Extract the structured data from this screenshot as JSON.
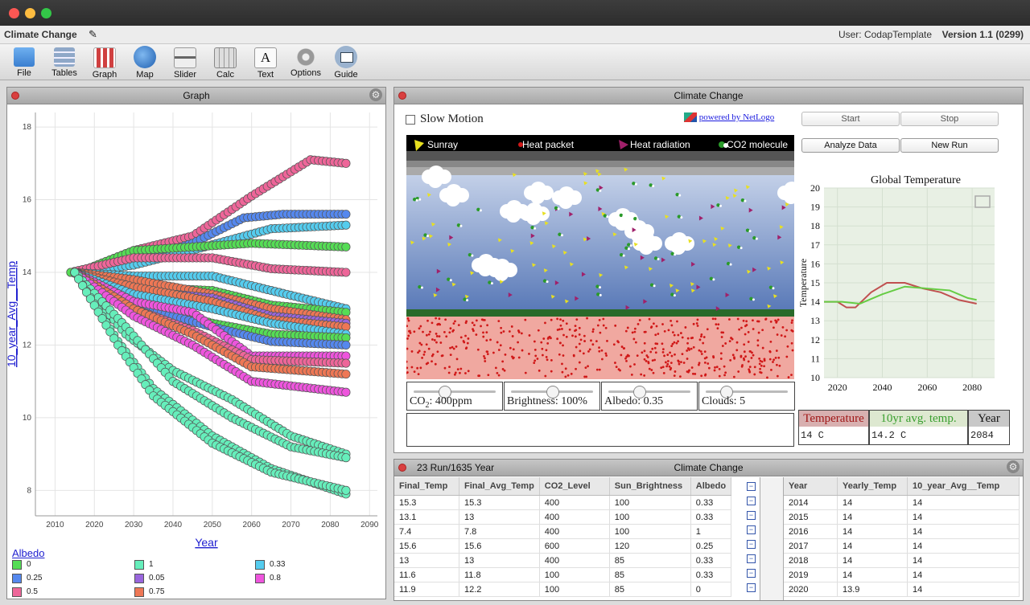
{
  "app": {
    "title": "Climate Change",
    "user": "User: CodapTemplate",
    "version": "Version 1.1 (0299)"
  },
  "toolbar": [
    {
      "label": "File",
      "icon": "folder-icon",
      "color": "#4a8fd8"
    },
    {
      "label": "Tables",
      "icon": "table-icon",
      "color": "#8fa8c8"
    },
    {
      "label": "Graph",
      "icon": "graph-icon",
      "color": "#d04040"
    },
    {
      "label": "Map",
      "icon": "globe-icon",
      "color": "#2f6fc0"
    },
    {
      "label": "Slider",
      "icon": "slider-icon",
      "color": "#888888"
    },
    {
      "label": "Calc",
      "icon": "calculator-icon",
      "color": "#bbbbbb"
    },
    {
      "label": "Text",
      "icon": "text-icon",
      "color": "#f6f6f6"
    },
    {
      "label": "Options",
      "icon": "gear-icon",
      "color": "#999999"
    },
    {
      "label": "Guide",
      "icon": "book-icon",
      "color": "#4b6a92"
    }
  ],
  "graph_panel": {
    "title": "Graph",
    "legend_title": "Albedo",
    "legend": [
      {
        "label": "0",
        "color": "#55dd55"
      },
      {
        "label": "1",
        "color": "#66eebb"
      },
      {
        "label": "0.33",
        "color": "#55ccee"
      },
      {
        "label": "0.25",
        "color": "#5588ee"
      },
      {
        "label": "0.05",
        "color": "#9966dd"
      },
      {
        "label": "0.8",
        "color": "#ee55dd"
      },
      {
        "label": "0.5",
        "color": "#ee6699"
      },
      {
        "label": "0.75",
        "color": "#ee7755"
      }
    ]
  },
  "chart_data": [
    {
      "type": "scatter",
      "xlabel": "Year",
      "ylabel": "10_year_Avg__Temp",
      "xlim": [
        2005,
        2092
      ],
      "ylim": [
        7.3,
        18.4
      ],
      "x_ticks": [
        "2010",
        "2020",
        "2030",
        "2040",
        "2050",
        "2060",
        "2070",
        "2080",
        "2090"
      ],
      "y_ticks": [
        "8",
        "10",
        "12",
        "14",
        "16",
        "18"
      ],
      "series": [
        {
          "name": "0.5",
          "color": "#ee6699",
          "points": [
            [
              2016,
              14
            ],
            [
              2030,
              14.6
            ],
            [
              2045,
              15
            ],
            [
              2060,
              16.1
            ],
            [
              2075,
              17.1
            ],
            [
              2084,
              17
            ]
          ]
        },
        {
          "name": "0.25",
          "color": "#5588ee",
          "points": [
            [
              2016,
              14
            ],
            [
              2030,
              14.3
            ],
            [
              2045,
              14.8
            ],
            [
              2058,
              15.5
            ],
            [
              2068,
              15.6
            ],
            [
              2084,
              15.6
            ]
          ]
        },
        {
          "name": "0.33",
          "color": "#55ccee",
          "points": [
            [
              2016,
              14
            ],
            [
              2030,
              14.2
            ],
            [
              2048,
              14.7
            ],
            [
              2065,
              15.2
            ],
            [
              2084,
              15.3
            ]
          ]
        },
        {
          "name": "0",
          "color": "#55dd55",
          "points": [
            [
              2016,
              14
            ],
            [
              2030,
              14.6
            ],
            [
              2045,
              14.7
            ],
            [
              2060,
              14.8
            ],
            [
              2084,
              14.7
            ]
          ]
        },
        {
          "name": "0.5",
          "color": "#ee6699",
          "points": [
            [
              2014,
              14
            ],
            [
              2030,
              14.4
            ],
            [
              2050,
              14.4
            ],
            [
              2065,
              14.1
            ],
            [
              2084,
              14
            ]
          ]
        },
        {
          "name": "0.33",
          "color": "#55ccee",
          "points": [
            [
              2014,
              14
            ],
            [
              2030,
              13.9
            ],
            [
              2050,
              13.9
            ],
            [
              2065,
              13.5
            ],
            [
              2084,
              13
            ]
          ]
        },
        {
          "name": "0",
          "color": "#55dd55",
          "points": [
            [
              2014,
              14
            ],
            [
              2030,
              13.6
            ],
            [
              2050,
              13.5
            ],
            [
              2065,
              13.1
            ],
            [
              2084,
              12.9
            ]
          ]
        },
        {
          "name": "0.75",
          "color": "#ee7755",
          "points": [
            [
              2015,
              14
            ],
            [
              2030,
              13.8
            ],
            [
              2050,
              13.4
            ],
            [
              2065,
              13
            ],
            [
              2084,
              12.7
            ]
          ]
        },
        {
          "name": "0.05",
          "color": "#9966dd",
          "points": [
            [
              2015,
              14
            ],
            [
              2030,
              13.5
            ],
            [
              2050,
              13.3
            ],
            [
              2065,
              12.8
            ],
            [
              2084,
              12.6
            ]
          ]
        },
        {
          "name": "0.75",
          "color": "#ee7755",
          "points": [
            [
              2015,
              14
            ],
            [
              2030,
              13.6
            ],
            [
              2050,
              13.2
            ],
            [
              2065,
              12.7
            ],
            [
              2084,
              12.5
            ]
          ]
        },
        {
          "name": "0.33",
          "color": "#55ccee",
          "points": [
            [
              2015,
              14
            ],
            [
              2030,
              13.4
            ],
            [
              2050,
              13
            ],
            [
              2065,
              12.6
            ],
            [
              2084,
              12.3
            ]
          ]
        },
        {
          "name": "0",
          "color": "#55dd55",
          "points": [
            [
              2015,
              14
            ],
            [
              2030,
              13.2
            ],
            [
              2050,
              12.6
            ],
            [
              2065,
              12.3
            ],
            [
              2084,
              12.2
            ]
          ]
        },
        {
          "name": "0.25",
          "color": "#5588ee",
          "points": [
            [
              2015,
              14
            ],
            [
              2030,
              13.1
            ],
            [
              2050,
              12.5
            ],
            [
              2065,
              12.1
            ],
            [
              2084,
              12
            ]
          ]
        },
        {
          "name": "0.8",
          "color": "#ee55dd",
          "points": [
            [
              2015,
              14
            ],
            [
              2030,
              13.2
            ],
            [
              2045,
              12.9
            ],
            [
              2060,
              11.7
            ],
            [
              2084,
              11.7
            ]
          ]
        },
        {
          "name": "0.5",
          "color": "#ee6699",
          "points": [
            [
              2015,
              14
            ],
            [
              2030,
              13
            ],
            [
              2045,
              12.4
            ],
            [
              2060,
              11.6
            ],
            [
              2084,
              11.5
            ]
          ]
        },
        {
          "name": "0.75",
          "color": "#ee7755",
          "points": [
            [
              2015,
              14
            ],
            [
              2030,
              13
            ],
            [
              2045,
              12.3
            ],
            [
              2060,
              11.4
            ],
            [
              2084,
              11.2
            ]
          ]
        },
        {
          "name": "0.8",
          "color": "#ee55dd",
          "points": [
            [
              2015,
              14
            ],
            [
              2030,
              12.8
            ],
            [
              2045,
              12
            ],
            [
              2060,
              11
            ],
            [
              2084,
              10.7
            ]
          ]
        },
        {
          "name": "1",
          "color": "#66eebb",
          "points": [
            [
              2015,
              14
            ],
            [
              2028,
              12.3
            ],
            [
              2040,
              11.3
            ],
            [
              2055,
              10.5
            ],
            [
              2070,
              9.5
            ],
            [
              2084,
              9
            ]
          ]
        },
        {
          "name": "1",
          "color": "#66eebb",
          "points": [
            [
              2015,
              14
            ],
            [
              2028,
              12.5
            ],
            [
              2040,
              11
            ],
            [
              2055,
              10
            ],
            [
              2070,
              9.2
            ],
            [
              2084,
              8.9
            ]
          ]
        },
        {
          "name": "1",
          "color": "#66eebb",
          "points": [
            [
              2015,
              14
            ],
            [
              2026,
              12.1
            ],
            [
              2035,
              10.8
            ],
            [
              2050,
              9.5
            ],
            [
              2065,
              8.6
            ],
            [
              2084,
              7.9
            ]
          ]
        },
        {
          "name": "1",
          "color": "#66eebb",
          "points": [
            [
              2015,
              14
            ],
            [
              2026,
              12
            ],
            [
              2035,
              10.6
            ],
            [
              2050,
              9.3
            ],
            [
              2065,
              8.5
            ],
            [
              2084,
              8
            ]
          ]
        }
      ]
    },
    {
      "type": "line",
      "title": "Global Temperature",
      "xlabel": "Year",
      "ylabel": "Temperature",
      "xlim": [
        2014,
        2024
      ],
      "ylim": [
        10,
        20
      ],
      "x_ticks": [
        "2020",
        "2040",
        "2060",
        "2080"
      ],
      "y_ticks": [
        "10",
        "11",
        "12",
        "13",
        "14",
        "15",
        "16",
        "17",
        "18",
        "19",
        "20"
      ],
      "series": [
        {
          "name": "Temperature",
          "color": "#c05050",
          "x": [
            2014,
            2020,
            2024,
            2028,
            2035,
            2042,
            2050,
            2058,
            2066,
            2074,
            2082
          ],
          "y": [
            14,
            14,
            13.7,
            13.7,
            14.5,
            15,
            15,
            14.7,
            14.5,
            14.1,
            13.9
          ]
        },
        {
          "name": "10yr avg. temp.",
          "color": "#66cc44",
          "x": [
            2014,
            2022,
            2030,
            2040,
            2050,
            2060,
            2070,
            2078,
            2082
          ],
          "y": [
            14,
            14,
            13.9,
            14.4,
            14.8,
            14.7,
            14.6,
            14.2,
            14.1
          ]
        }
      ]
    }
  ],
  "netlogo": {
    "panel_title": "Climate Change",
    "slow_motion": "Slow Motion",
    "powered": "powered by NetLogo",
    "start": "Start",
    "stop": "Stop",
    "analyze": "Analyze Data",
    "new_run": "New Run",
    "legend": {
      "sunray": "Sunray",
      "heat_packet": "Heat packet",
      "heat_radiation": "Heat radiation",
      "co2": "CO2 molecule"
    },
    "sliders": [
      {
        "label_pre": "CO",
        "label_sub": "2",
        "label_post": ": 400ppm",
        "level": 0.35
      },
      {
        "label_pre": "Brightness: 100%",
        "label_sub": "",
        "label_post": "",
        "level": 0.5
      },
      {
        "label_pre": "Albedo: 0.35",
        "label_sub": "",
        "label_post": "",
        "level": 0.35
      },
      {
        "label_pre": "Clouds: 5",
        "label_sub": "",
        "label_post": "",
        "level": 0.2
      }
    ],
    "monitors": [
      {
        "label": "Temperature",
        "value": "14 C",
        "label_color": "#a01818",
        "bg": "#d8b0b0"
      },
      {
        "label": "10yr avg. temp.",
        "value": "14.2 C",
        "label_color": "#3aa030",
        "bg": "#dde8d0"
      },
      {
        "label": "Year",
        "value": "2084",
        "label_color": "#111111",
        "bg": "#c8c8c8"
      }
    ]
  },
  "table_panel": {
    "title": "Climate Change",
    "case_count": "23 Run/1635 Year",
    "left_headers": [
      "Final_Temp",
      "Final_Avg_Temp",
      "CO2_Level",
      "Sun_Brightness",
      "Albedo"
    ],
    "left_rows": [
      [
        "15.3",
        "15.3",
        "400",
        "100",
        "0.33"
      ],
      [
        "13.1",
        "13",
        "400",
        "100",
        "0.33"
      ],
      [
        "7.4",
        "7.8",
        "400",
        "100",
        "1"
      ],
      [
        "15.6",
        "15.6",
        "600",
        "120",
        "0.25"
      ],
      [
        "13",
        "13",
        "400",
        "85",
        "0.33"
      ],
      [
        "11.6",
        "11.8",
        "100",
        "85",
        "0.33"
      ],
      [
        "11.9",
        "12.2",
        "100",
        "85",
        "0"
      ]
    ],
    "right_headers": [
      "Year",
      "Yearly_Temp",
      "10_year_Avg__Temp"
    ],
    "right_rows": [
      [
        "2014",
        "14",
        "14"
      ],
      [
        "2015",
        "14",
        "14"
      ],
      [
        "2016",
        "14",
        "14"
      ],
      [
        "2017",
        "14",
        "14"
      ],
      [
        "2018",
        "14",
        "14"
      ],
      [
        "2019",
        "14",
        "14"
      ],
      [
        "2020",
        "13.9",
        "14"
      ]
    ]
  }
}
